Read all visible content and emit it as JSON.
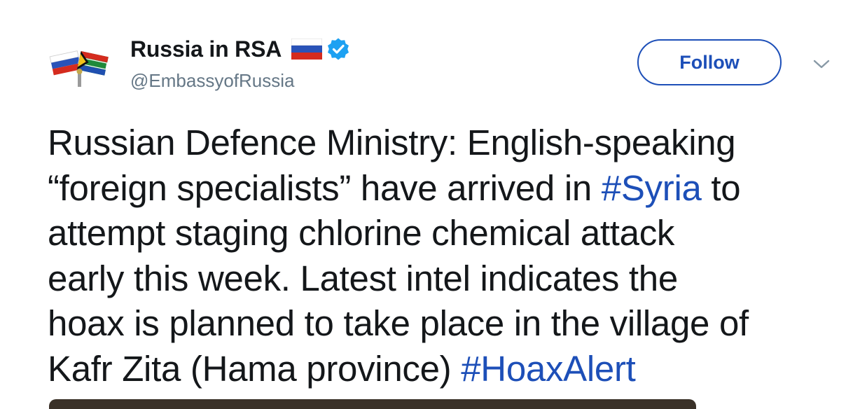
{
  "account": {
    "display_name": "Russia in RSA",
    "handle": "@EmbassyofRussia",
    "verified": true,
    "avatar_icon": "crossed-flags-pin-icon",
    "name_emoji_icon": "russia-flag-icon",
    "verified_icon": "verified-badge-icon"
  },
  "actions": {
    "follow_label": "Follow",
    "more_icon": "chevron-down-icon"
  },
  "tweet": {
    "line1": "Russian Defence Ministry: English-speaking",
    "line2_a": "“foreign specialists” have arrived in ",
    "hashtag_syria": "#Syria",
    "line2_b": " to",
    "line3": "attempt staging chlorine chemical attack",
    "line4": "early this week. Latest intel indicates the",
    "line5": "hoax is planned to take place in the village of",
    "line6_a": "Kafr Zita (Hama province) ",
    "hashtag_hoax": "#HoaxAlert"
  },
  "colors": {
    "link": "#1d4fb8",
    "text": "#14171a",
    "muted": "#657786",
    "verified": "#1da1f2"
  }
}
